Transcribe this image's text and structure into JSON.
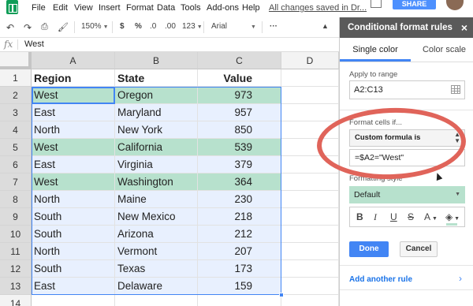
{
  "menubar": {
    "items": [
      "File",
      "Edit",
      "View",
      "Insert",
      "Format",
      "Data",
      "Tools",
      "Add-ons",
      "Help"
    ],
    "save_status": "All changes saved in Dr...",
    "share_label": "SHARE"
  },
  "toolbar": {
    "zoom": "150%",
    "currency": "$",
    "percent": "%",
    "decrease_decimals": ".0",
    "increase_decimals": ".00",
    "more_formats": "123",
    "font": "Arial",
    "more": "···"
  },
  "formula_bar": {
    "fx": "fx",
    "value": "West"
  },
  "sheet": {
    "columns": [
      "A",
      "B",
      "C",
      "D"
    ],
    "rows": [
      [
        "Region",
        "State",
        "Value"
      ],
      [
        "West",
        "Oregon",
        "973"
      ],
      [
        "East",
        "Maryland",
        "957"
      ],
      [
        "North",
        "New York",
        "850"
      ],
      [
        "West",
        "California",
        "539"
      ],
      [
        "East",
        "Virginia",
        "379"
      ],
      [
        "West",
        "Washington",
        "364"
      ],
      [
        "North",
        "Maine",
        "230"
      ],
      [
        "South",
        "New Mexico",
        "218"
      ],
      [
        "South",
        "Arizona",
        "212"
      ],
      [
        "North",
        "Vermont",
        "207"
      ],
      [
        "South",
        "Texas",
        "173"
      ],
      [
        "East",
        "Delaware",
        "159"
      ],
      [
        "",
        "",
        ""
      ]
    ],
    "highlight_color": "#b7e1cd",
    "selection_fill": "#e8f0fe"
  },
  "panel": {
    "title": "Conditional format rules",
    "close": "×",
    "tabs": [
      "Single color",
      "Color scale"
    ],
    "apply_label": "Apply to range",
    "range": "A2:C13",
    "format_label": "Format cells if...",
    "condition": "Custom formula is",
    "formula": "=$A2=\"West\"",
    "style_label": "Formatting style",
    "style_value": "Default",
    "format_buttons": [
      "B",
      "I",
      "U",
      "S",
      "A"
    ],
    "done": "Done",
    "cancel": "Cancel",
    "add_rule": "Add another rule",
    "add_chevron": "›"
  }
}
